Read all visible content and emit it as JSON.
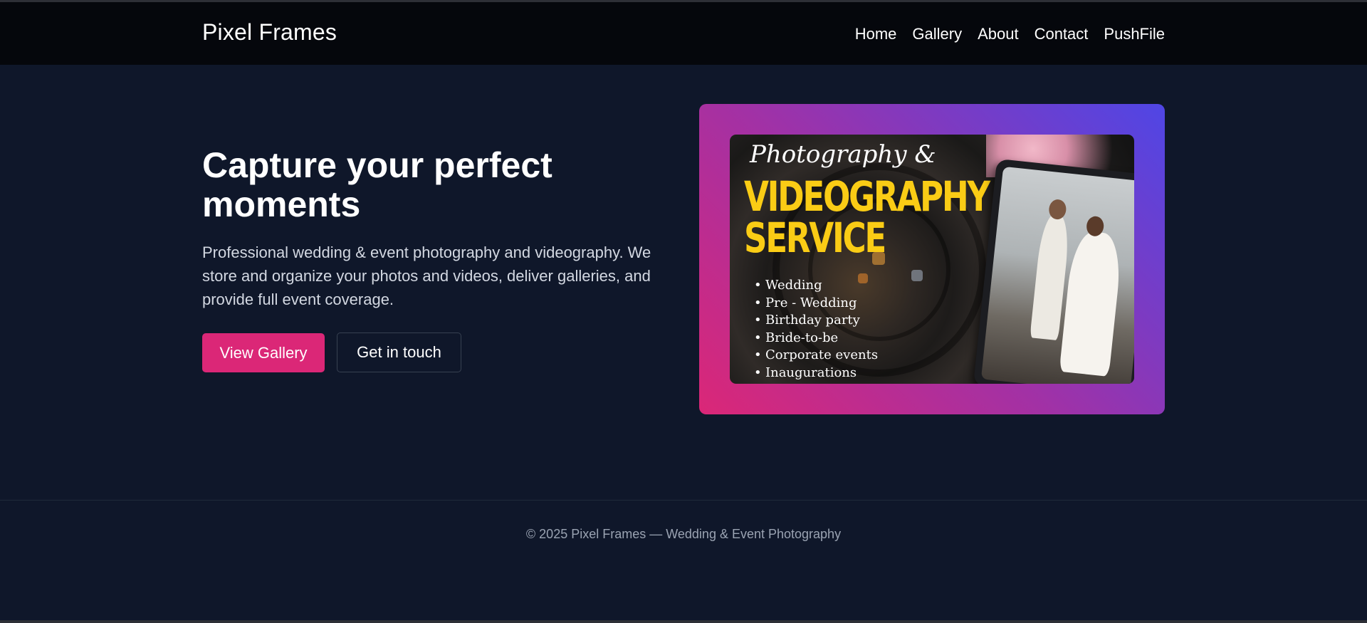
{
  "brand": "Pixel Frames",
  "nav": [
    "Home",
    "Gallery",
    "About",
    "Contact",
    "PushFile"
  ],
  "hero": {
    "title": "Capture your perfect moments",
    "description": "Professional wedding & event photography and videography. We store and organize your photos and videos, deliver galleries, and provide full event coverage.",
    "primary_button": "View Gallery",
    "secondary_button": "Get in touch"
  },
  "promo": {
    "script_title": "Photography &",
    "heading_line1": "VIDEOGRAPHY",
    "heading_line2": "SERVICE",
    "services": [
      "Wedding",
      "Pre - Wedding",
      "Birthday party",
      "Bride-to-be",
      "Corporate events",
      "Inaugurations"
    ]
  },
  "footer": "© 2025 Pixel Frames — Wedding & Event Photography",
  "colors": {
    "background": "#0f172a",
    "header": "#05070c",
    "accent": "#db2777",
    "gradient_start": "#db2777",
    "gradient_end": "#4f46e5",
    "promo_heading": "#facc15"
  }
}
